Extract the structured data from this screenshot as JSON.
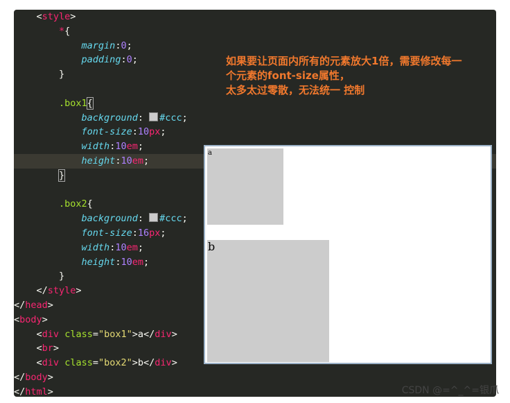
{
  "code": {
    "style_open": "style",
    "star": "*",
    "margin_prop": "margin",
    "margin_val": "0",
    "padding_prop": "padding",
    "padding_val": "0",
    "box1_sel": ".box1",
    "background_prop": "background",
    "color_val": "#ccc",
    "fontsize_prop": "font-size",
    "box1_fontsize_num": "10",
    "px_unit": "px",
    "width_prop": "width",
    "height_prop": "height",
    "em_num": "10",
    "em_unit": "em",
    "box2_sel": ".box2",
    "box2_fontsize_num": "16",
    "style_close": "style",
    "head_close": "head",
    "body_open": "body",
    "div_tag": "div",
    "class_attr": "class",
    "box1_str": "\"box1\"",
    "box1_text": "a",
    "br_tag": "br",
    "box2_str": "\"box2\"",
    "box2_text": "b",
    "body_close": "body",
    "html_close": "html"
  },
  "note": {
    "line1": "如果要让页面内所有的元素放大1倍，需要修改每一",
    "line2": "个元素的font-size属性，",
    "line3": "太多太过零散，无法统一 控制"
  },
  "preview": {
    "box1_text": "a",
    "box2_text": "b",
    "box_color": "#cccccc"
  },
  "watermark": "CSDN @=^_^=银爪"
}
